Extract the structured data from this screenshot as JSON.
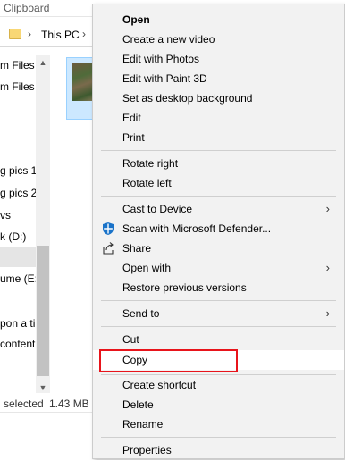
{
  "explorer": {
    "ribbon_label": "Clipboard",
    "address": {
      "crumb": "This PC",
      "sep1": "›",
      "sep2": "›"
    },
    "nav_items": [
      {
        "label": "m Files"
      },
      {
        "label": "m Files ("
      },
      {
        "label": "g pics 1"
      },
      {
        "label": "g pics 2"
      },
      {
        "label": "vs"
      },
      {
        "label": "k (D:)"
      },
      {
        "label": ""
      },
      {
        "label": "ume (E:)"
      },
      {
        "label": "pon a ti"
      },
      {
        "label": "content"
      }
    ],
    "scroll": {
      "up": "▲",
      "down": "▼"
    },
    "status": {
      "selected": "selected",
      "size": "1.43 MB"
    }
  },
  "context_menu": {
    "groups": [
      [
        {
          "label": "Open",
          "bold": true
        },
        {
          "label": "Create a new video"
        },
        {
          "label": "Edit with Photos"
        },
        {
          "label": "Edit with Paint 3D"
        },
        {
          "label": "Set as desktop background"
        },
        {
          "label": "Edit"
        },
        {
          "label": "Print"
        }
      ],
      [
        {
          "label": "Rotate right"
        },
        {
          "label": "Rotate left"
        }
      ],
      [
        {
          "label": "Cast to Device",
          "submenu": true
        },
        {
          "label": "Scan with Microsoft Defender...",
          "icon": "defender-shield-icon"
        },
        {
          "label": "Share",
          "icon": "share-icon"
        },
        {
          "label": "Open with",
          "submenu": true
        },
        {
          "label": "Restore previous versions"
        }
      ],
      [
        {
          "label": "Send to",
          "submenu": true
        }
      ],
      [
        {
          "label": "Cut"
        },
        {
          "label": "Copy",
          "highlighted": true
        }
      ],
      [
        {
          "label": "Create shortcut"
        },
        {
          "label": "Delete"
        },
        {
          "label": "Rename"
        }
      ],
      [
        {
          "label": "Properties"
        }
      ]
    ],
    "submenu_arrow": "›",
    "highlight_color": "#e8141b"
  }
}
